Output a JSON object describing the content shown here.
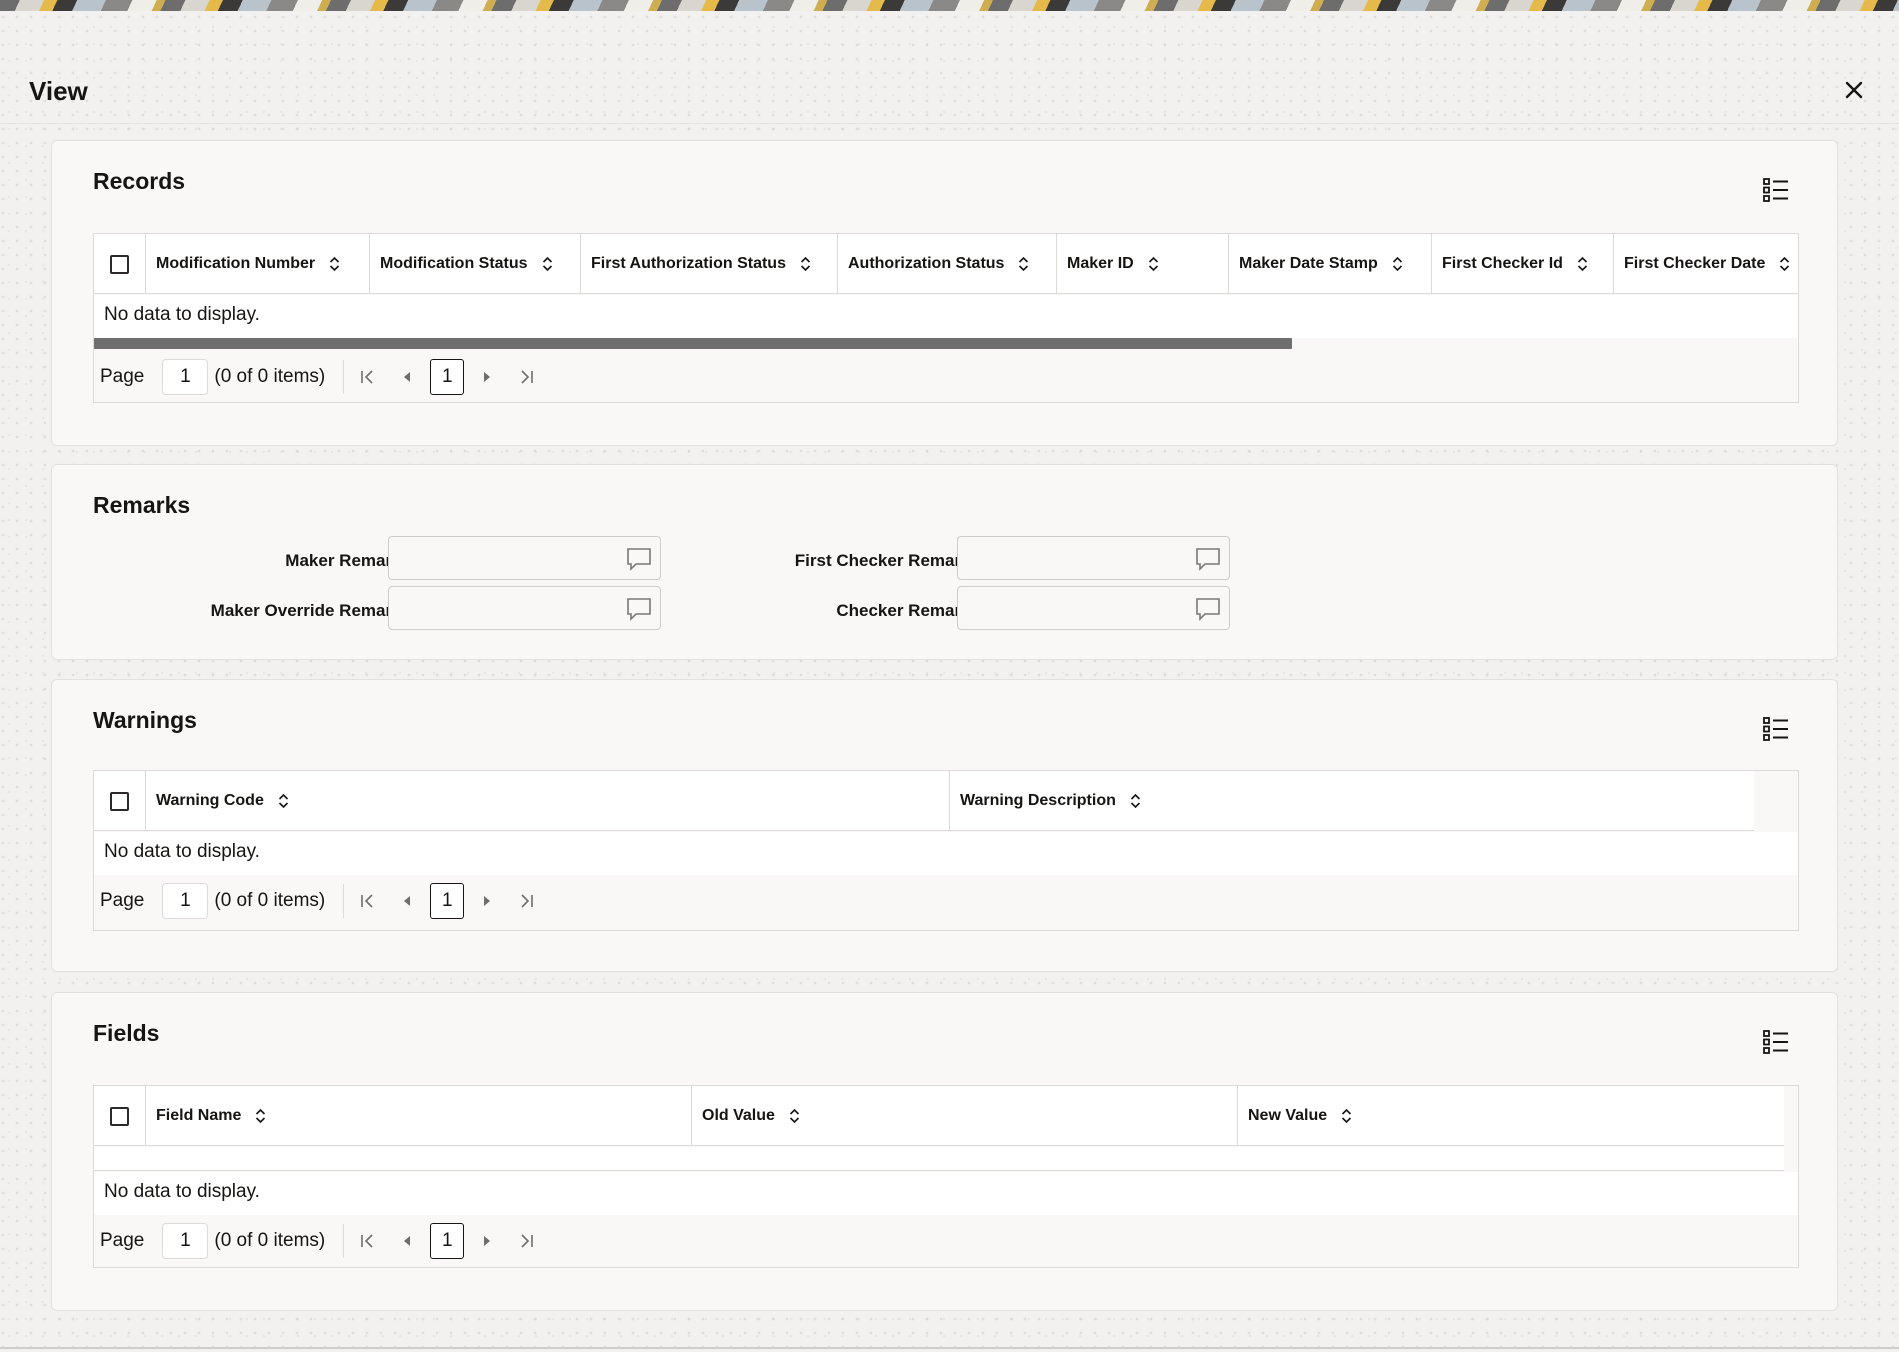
{
  "dialog": {
    "title": "View"
  },
  "records": {
    "title": "Records",
    "columns": [
      "Modification Number",
      "Modification Status",
      "First Authorization Status",
      "Authorization Status",
      "Maker ID",
      "Maker Date Stamp",
      "First Checker Id",
      "First Checker Date"
    ],
    "no_data": "No data to display.",
    "pager": {
      "label": "Page",
      "page": "1",
      "info": "(0 of 0 items)",
      "current": "1"
    }
  },
  "remarks": {
    "title": "Remarks",
    "maker_remarks": "Maker Remarks",
    "maker_override_remarks": "Maker Override Remarks",
    "first_checker_remarks": "First Checker Remarks",
    "checker_remarks": "Checker Remarks"
  },
  "warnings": {
    "title": "Warnings",
    "columns": [
      "Warning Code",
      "Warning Description"
    ],
    "no_data": "No data to display.",
    "pager": {
      "label": "Page",
      "page": "1",
      "info": "(0 of 0 items)",
      "current": "1"
    }
  },
  "fields": {
    "title": "Fields",
    "columns": [
      "Field Name",
      "Old Value",
      "New Value"
    ],
    "no_data": "No data to display.",
    "pager": {
      "label": "Page",
      "page": "1",
      "info": "(0 of 0 items)",
      "current": "1"
    }
  },
  "icons": {
    "close": "close-icon",
    "column_picker": "list-settings-icon",
    "sort": "sort-updown-icon",
    "remark": "chat-bubble-icon"
  }
}
